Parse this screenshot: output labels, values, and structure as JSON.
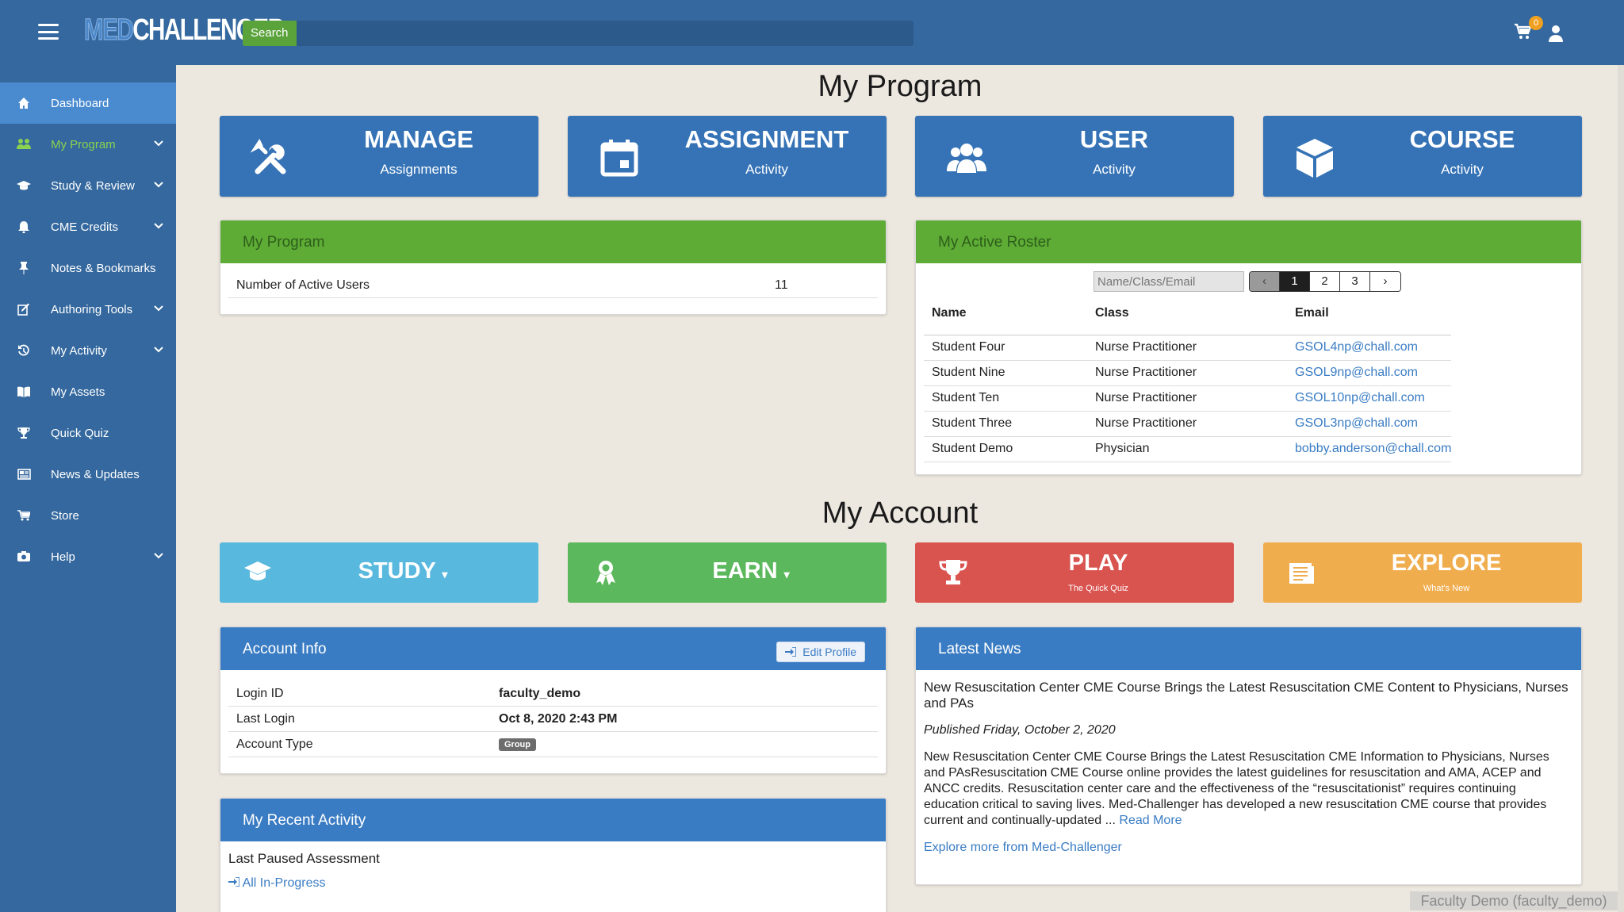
{
  "header": {
    "logo_med": "MED",
    "logo_challenger": "CHALLENGER",
    "search_button": "Search",
    "search_placeholder": "",
    "cart_count": "0"
  },
  "sidebar": {
    "items": [
      {
        "label": "Dashboard",
        "icon": "home-icon"
      },
      {
        "label": "My Program",
        "icon": "users-icon"
      },
      {
        "label": "Study & Review",
        "icon": "graduation-cap-icon"
      },
      {
        "label": "CME Credits",
        "icon": "bell-icon"
      },
      {
        "label": "Notes & Bookmarks",
        "icon": "thumbtack-icon"
      },
      {
        "label": "Authoring Tools",
        "icon": "edit-icon"
      },
      {
        "label": "My Activity",
        "icon": "history-icon"
      },
      {
        "label": "My Assets",
        "icon": "book-icon"
      },
      {
        "label": "Quick Quiz",
        "icon": "trophy-icon"
      },
      {
        "label": "News & Updates",
        "icon": "newspaper-icon"
      },
      {
        "label": "Store",
        "icon": "cart-icon"
      },
      {
        "label": "Help",
        "icon": "life-ring-icon"
      }
    ]
  },
  "my_program": {
    "title": "My Program",
    "tiles": [
      {
        "title": "MANAGE",
        "subtitle": "Assignments",
        "icon": "tools-icon"
      },
      {
        "title": "ASSIGNMENT",
        "subtitle": "Activity",
        "icon": "calendar-icon"
      },
      {
        "title": "USER",
        "subtitle": "Activity",
        "icon": "users-icon"
      },
      {
        "title": "COURSE",
        "subtitle": "Activity",
        "icon": "cube-icon"
      }
    ],
    "panel": {
      "title": "My Program",
      "rows": [
        {
          "label": "Number of Active Users",
          "value": "11"
        }
      ]
    }
  },
  "roster": {
    "title": "My Active Roster",
    "search_placeholder": "Name/Class/Email",
    "pager": {
      "prev": "‹",
      "pages": [
        "1",
        "2",
        "3"
      ],
      "next": "›",
      "current": "1"
    },
    "columns": [
      "Name",
      "Class",
      "Email"
    ],
    "rows": [
      [
        "Student Four",
        "Nurse Practitioner",
        "GSOL4np@chall.com"
      ],
      [
        "Student Nine",
        "Nurse Practitioner",
        "GSOL9np@chall.com"
      ],
      [
        "Student Ten",
        "Nurse Practitioner",
        "GSOL10np@chall.com"
      ],
      [
        "Student Three",
        "Nurse Practitioner",
        "GSOL3np@chall.com"
      ],
      [
        "Student Demo",
        "Physician",
        "bobby.anderson@chall.com"
      ]
    ]
  },
  "my_account": {
    "title": "My Account",
    "tiles": [
      {
        "title": "STUDY",
        "subtitle": "",
        "icon": "graduation-cap-icon",
        "color": "#58b8de"
      },
      {
        "title": "EARN",
        "subtitle": "",
        "icon": "award-icon",
        "color": "#5cb85c"
      },
      {
        "title": "PLAY",
        "subtitle": "The Quick Quiz",
        "icon": "trophy-icon",
        "color": "#d9534f"
      },
      {
        "title": "EXPLORE",
        "subtitle": "What's New",
        "icon": "newspaper-icon",
        "color": "#f0ad4e"
      }
    ]
  },
  "account_info": {
    "title": "Account Info",
    "edit_label": "Edit Profile",
    "rows": [
      {
        "label": "Login ID",
        "value": "faculty_demo"
      },
      {
        "label": "Last Login",
        "value": "Oct 8, 2020 2:43 PM"
      },
      {
        "label": "Account Type",
        "value": "Group"
      }
    ]
  },
  "recent_activity": {
    "title": "My Recent Activity",
    "item": "Last Paused Assessment",
    "link": "All In-Progress"
  },
  "news": {
    "title": "Latest News",
    "headline": "New Resuscitation Center CME Course Brings the Latest Resuscitation CME Content to Physicians, Nurses and PAs",
    "published": "Published Friday, October 2, 2020",
    "body": "New Resuscitation Center CME Course Brings the Latest Resuscitation CME Information to Physicians, Nurses and PAsResuscitation CME Course online provides the latest guidelines for resuscitation and AMA, ACEP and ANCC credits. Resuscitation center care and the effectiveness of the “resuscitationist” requires continuing education critical to saving lives.  Med-Challenger has developed a new resuscitation CME course that provides current and continually-updated ...",
    "read_more": "Read More",
    "explore": "Explore more from Med-Challenger"
  },
  "footer": {
    "user": "Faculty Demo (faculty_demo)"
  }
}
